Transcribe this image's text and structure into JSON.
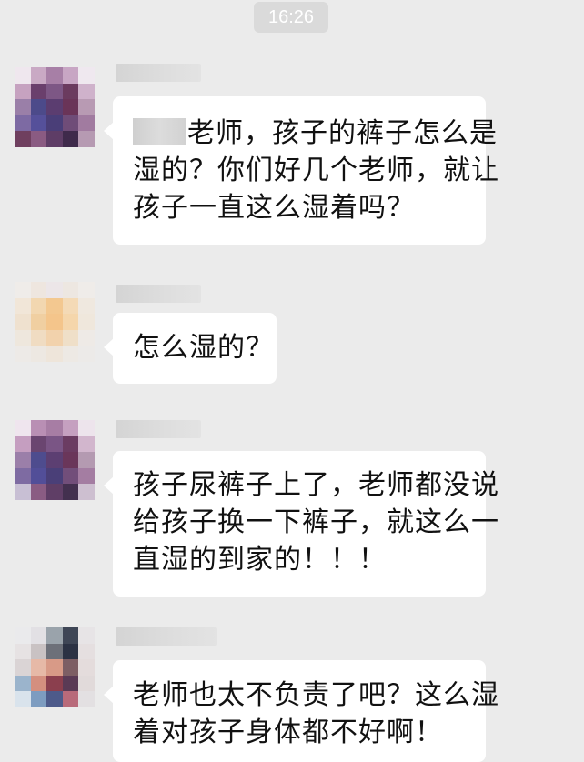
{
  "chat": {
    "timestamp": "16:26",
    "messages": [
      {
        "sender_avatar": "blurred-avatar",
        "lines": [
          "老师，孩子的裤子怎么是",
          "湿的？你们好几个老师，就让",
          "孩子一直这么湿着吗？"
        ]
      },
      {
        "sender_avatar": "blurred-avatar",
        "lines": [
          "怎么湿的？"
        ]
      },
      {
        "sender_avatar": "blurred-avatar",
        "lines": [
          "孩子尿裤子上了，老师都没说",
          "给孩子换一下裤子，就这么一",
          "直湿的到家的！！！"
        ]
      },
      {
        "sender_avatar": "blurred-avatar",
        "lines": [
          "老师也太不负责了吧？这么湿",
          "着对孩子身体都不好啊！"
        ]
      }
    ]
  },
  "colors": {
    "background": "#ebebeb",
    "bubble": "#ffffff",
    "timestamp_pill": "#dadada",
    "text": "#111111"
  }
}
